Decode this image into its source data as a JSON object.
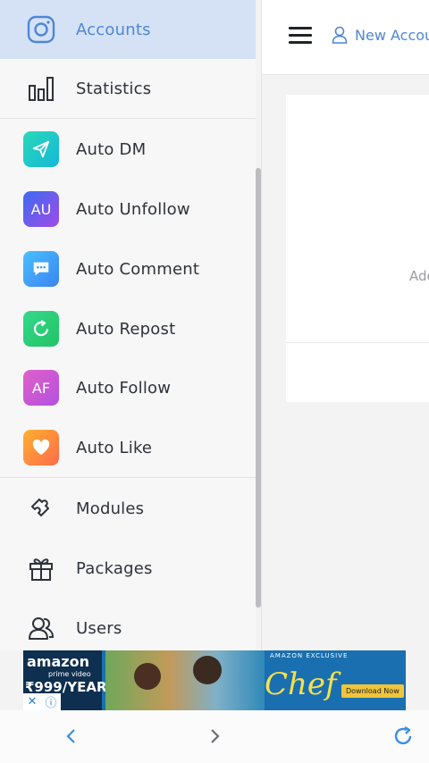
{
  "sidebar": {
    "items": [
      {
        "label": "Accounts",
        "icon": "instagram-icon"
      },
      {
        "label": "Statistics",
        "icon": "bar-chart-icon"
      },
      {
        "label": "Auto DM",
        "icon": "send-icon",
        "badge_color": "#16c4c8"
      },
      {
        "label": "Auto Unfollow",
        "icon": "AU",
        "badge_color": "#6a5bf0"
      },
      {
        "label": "Auto Comment",
        "icon": "chat-icon",
        "badge_color": "#3aa0f8"
      },
      {
        "label": "Auto Repost",
        "icon": "repost-icon",
        "badge_color": "#2fd06e"
      },
      {
        "label": "Auto Follow",
        "icon": "AF",
        "badge_color": "#c856d8"
      },
      {
        "label": "Auto Like",
        "icon": "heart-icon",
        "badge_color": "#ff8a3a"
      },
      {
        "label": "Modules",
        "icon": "puzzle-icon"
      },
      {
        "label": "Packages",
        "icon": "gift-icon"
      },
      {
        "label": "Users",
        "icon": "users-icon"
      }
    ]
  },
  "header": {
    "new_account_label": "New Accou"
  },
  "main": {
    "card_text": "Ade"
  },
  "ad": {
    "brand": "amazon",
    "sub": "prime video",
    "price": "₹999/YEAR",
    "exclusive": "AMAZON EXCLUSIVE",
    "title": "Chef",
    "cta": "Download Now"
  },
  "colors": {
    "accent": "#4f86d6",
    "active_bg": "#d5e2f6"
  }
}
